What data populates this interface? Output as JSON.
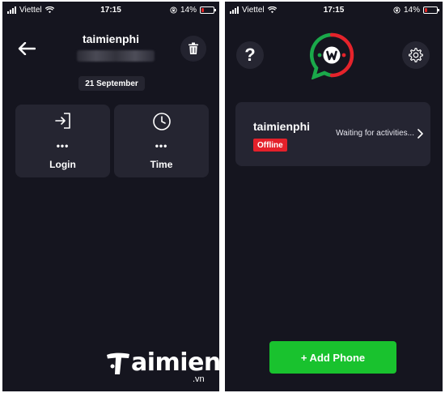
{
  "left_screen": {
    "status": {
      "carrier": "Viettel",
      "time": "17:15",
      "battery": "14%",
      "battery_level": 0.14
    },
    "header": {
      "title": "taimienphi"
    },
    "date_chip": "21 September",
    "tiles": [
      {
        "icon": "login-icon",
        "dots": "•••",
        "label": "Login"
      },
      {
        "icon": "clock-icon",
        "dots": "•••",
        "label": "Time"
      }
    ],
    "watermark": {
      "brand": "aimienphi",
      "suffix": ".vn"
    }
  },
  "right_screen": {
    "status": {
      "carrier": "Viettel",
      "time": "17:15",
      "battery": "14%",
      "battery_level": 0.14
    },
    "help_label": "?",
    "card": {
      "name": "taimienphi",
      "status": "Offline",
      "message": "Waiting for activities..."
    },
    "add_button": "+ Add Phone"
  },
  "colors": {
    "background": "#15151f",
    "tile": "#252531",
    "offline_badge": "#e4202a",
    "add_button": "#19c22e",
    "logo_red": "#e5232b",
    "logo_green": "#1aa84a"
  }
}
